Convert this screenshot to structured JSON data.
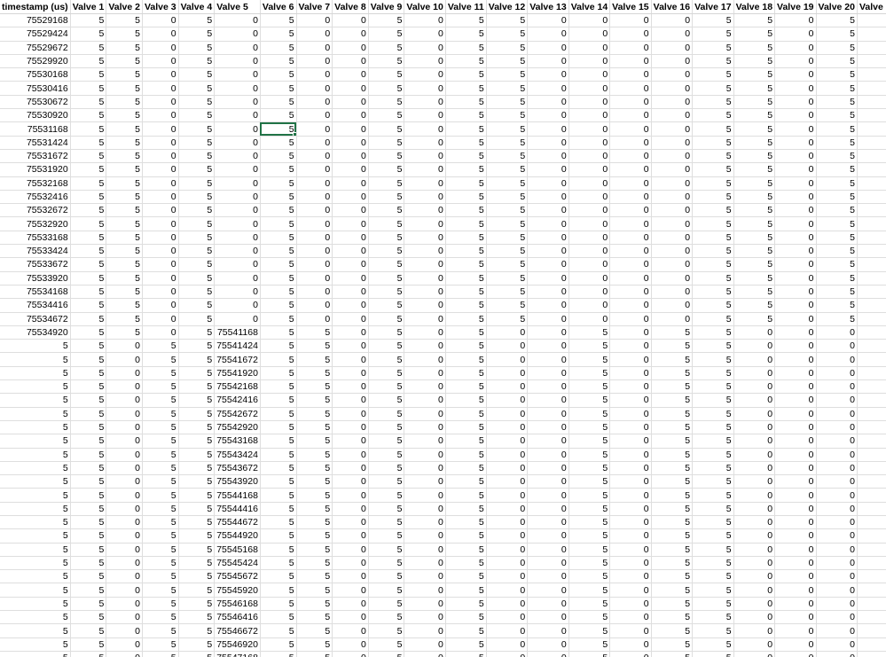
{
  "sheet": {
    "headers": [
      "timestamp (us)",
      "Valve 1",
      "Valve 2",
      "Valve 3",
      "Valve 4",
      "Valve 5",
      "Valve 6",
      "Valve 7",
      "Valve 8",
      "Valve 9",
      "Valve 10",
      "Valve 11",
      "Valve 12",
      "Valve 13",
      "Valve 14",
      "Valve 15",
      "Valve 16",
      "Valve 17",
      "Valve 18",
      "Valve 19",
      "Valve 20",
      "Valve 21"
    ],
    "selected_cell": {
      "row": 8,
      "col": 6
    },
    "rows": [
      [
        "75529168",
        "5",
        "5",
        "0",
        "5",
        "0",
        "5",
        "0",
        "0",
        "5",
        "0",
        "5",
        "5",
        "0",
        "0",
        "0",
        "0",
        "5",
        "5",
        "0",
        "5",
        "5"
      ],
      [
        "75529424",
        "5",
        "5",
        "0",
        "5",
        "0",
        "5",
        "0",
        "0",
        "5",
        "0",
        "5",
        "5",
        "0",
        "0",
        "0",
        "0",
        "5",
        "5",
        "0",
        "5",
        "5"
      ],
      [
        "75529672",
        "5",
        "5",
        "0",
        "5",
        "0",
        "5",
        "0",
        "0",
        "5",
        "0",
        "5",
        "5",
        "0",
        "0",
        "0",
        "0",
        "5",
        "5",
        "0",
        "5",
        "5"
      ],
      [
        "75529920",
        "5",
        "5",
        "0",
        "5",
        "0",
        "5",
        "0",
        "0",
        "5",
        "0",
        "5",
        "5",
        "0",
        "0",
        "0",
        "0",
        "5",
        "5",
        "0",
        "5",
        "5"
      ],
      [
        "75530168",
        "5",
        "5",
        "0",
        "5",
        "0",
        "5",
        "0",
        "0",
        "5",
        "0",
        "5",
        "5",
        "0",
        "0",
        "0",
        "0",
        "5",
        "5",
        "0",
        "5",
        "5"
      ],
      [
        "75530416",
        "5",
        "5",
        "0",
        "5",
        "0",
        "5",
        "0",
        "0",
        "5",
        "0",
        "5",
        "5",
        "0",
        "0",
        "0",
        "0",
        "5",
        "5",
        "0",
        "5",
        "5"
      ],
      [
        "75530672",
        "5",
        "5",
        "0",
        "5",
        "0",
        "5",
        "0",
        "0",
        "5",
        "0",
        "5",
        "5",
        "0",
        "0",
        "0",
        "0",
        "5",
        "5",
        "0",
        "5",
        "5"
      ],
      [
        "75530920",
        "5",
        "5",
        "0",
        "5",
        "0",
        "5",
        "0",
        "0",
        "5",
        "0",
        "5",
        "5",
        "0",
        "0",
        "0",
        "0",
        "5",
        "5",
        "0",
        "5",
        "5"
      ],
      [
        "75531168",
        "5",
        "5",
        "0",
        "5",
        "0",
        "5",
        "0",
        "0",
        "5",
        "0",
        "5",
        "5",
        "0",
        "0",
        "0",
        "0",
        "5",
        "5",
        "0",
        "5",
        "5"
      ],
      [
        "75531424",
        "5",
        "5",
        "0",
        "5",
        "0",
        "5",
        "0",
        "0",
        "5",
        "0",
        "5",
        "5",
        "0",
        "0",
        "0",
        "0",
        "5",
        "5",
        "0",
        "5",
        "5"
      ],
      [
        "75531672",
        "5",
        "5",
        "0",
        "5",
        "0",
        "5",
        "0",
        "0",
        "5",
        "0",
        "5",
        "5",
        "0",
        "0",
        "0",
        "0",
        "5",
        "5",
        "0",
        "5",
        "5"
      ],
      [
        "75531920",
        "5",
        "5",
        "0",
        "5",
        "0",
        "5",
        "0",
        "0",
        "5",
        "0",
        "5",
        "5",
        "0",
        "0",
        "0",
        "0",
        "5",
        "5",
        "0",
        "5",
        "5"
      ],
      [
        "75532168",
        "5",
        "5",
        "0",
        "5",
        "0",
        "5",
        "0",
        "0",
        "5",
        "0",
        "5",
        "5",
        "0",
        "0",
        "0",
        "0",
        "5",
        "5",
        "0",
        "5",
        "5"
      ],
      [
        "75532416",
        "5",
        "5",
        "0",
        "5",
        "0",
        "5",
        "0",
        "0",
        "5",
        "0",
        "5",
        "5",
        "0",
        "0",
        "0",
        "0",
        "5",
        "5",
        "0",
        "5",
        "5"
      ],
      [
        "75532672",
        "5",
        "5",
        "0",
        "5",
        "0",
        "5",
        "0",
        "0",
        "5",
        "0",
        "5",
        "5",
        "0",
        "0",
        "0",
        "0",
        "5",
        "5",
        "0",
        "5",
        "5"
      ],
      [
        "75532920",
        "5",
        "5",
        "0",
        "5",
        "0",
        "5",
        "0",
        "0",
        "5",
        "0",
        "5",
        "5",
        "0",
        "0",
        "0",
        "0",
        "5",
        "5",
        "0",
        "5",
        "5"
      ],
      [
        "75533168",
        "5",
        "5",
        "0",
        "5",
        "0",
        "5",
        "0",
        "0",
        "5",
        "0",
        "5",
        "5",
        "0",
        "0",
        "0",
        "0",
        "5",
        "5",
        "0",
        "5",
        "5"
      ],
      [
        "75533424",
        "5",
        "5",
        "0",
        "5",
        "0",
        "5",
        "0",
        "0",
        "5",
        "0",
        "5",
        "5",
        "0",
        "0",
        "0",
        "0",
        "5",
        "5",
        "0",
        "5",
        "5"
      ],
      [
        "75533672",
        "5",
        "5",
        "0",
        "5",
        "0",
        "5",
        "0",
        "0",
        "5",
        "0",
        "5",
        "5",
        "0",
        "0",
        "0",
        "0",
        "5",
        "5",
        "0",
        "5",
        "5"
      ],
      [
        "75533920",
        "5",
        "5",
        "0",
        "5",
        "0",
        "5",
        "0",
        "0",
        "5",
        "0",
        "5",
        "5",
        "0",
        "0",
        "0",
        "0",
        "5",
        "5",
        "0",
        "5",
        "5"
      ],
      [
        "75534168",
        "5",
        "5",
        "0",
        "5",
        "0",
        "5",
        "0",
        "0",
        "5",
        "0",
        "5",
        "5",
        "0",
        "0",
        "0",
        "0",
        "5",
        "5",
        "0",
        "5",
        "5"
      ],
      [
        "75534416",
        "5",
        "5",
        "0",
        "5",
        "0",
        "5",
        "0",
        "0",
        "5",
        "0",
        "5",
        "5",
        "0",
        "0",
        "0",
        "0",
        "5",
        "5",
        "0",
        "5",
        "5"
      ],
      [
        "75534672",
        "5",
        "5",
        "0",
        "5",
        "0",
        "5",
        "0",
        "0",
        "5",
        "0",
        "5",
        "5",
        "0",
        "0",
        "0",
        "0",
        "5",
        "5",
        "0",
        "5",
        "5"
      ],
      [
        "75534920",
        "5",
        "5",
        "0",
        "5",
        "75541168",
        "5",
        "5",
        "0",
        "5",
        "0",
        "5",
        "0",
        "0",
        "5",
        "0",
        "5",
        "5",
        "0",
        "0",
        "0",
        "0"
      ],
      [
        "5",
        "5",
        "0",
        "5",
        "5",
        "75541424",
        "5",
        "5",
        "0",
        "5",
        "0",
        "5",
        "0",
        "0",
        "5",
        "0",
        "5",
        "5",
        "0",
        "0",
        "0",
        "0"
      ],
      [
        "5",
        "5",
        "0",
        "5",
        "5",
        "75541672",
        "5",
        "5",
        "0",
        "5",
        "0",
        "5",
        "0",
        "0",
        "5",
        "0",
        "5",
        "5",
        "0",
        "0",
        "0",
        "0"
      ],
      [
        "5",
        "5",
        "0",
        "5",
        "5",
        "75541920",
        "5",
        "5",
        "0",
        "5",
        "0",
        "5",
        "0",
        "0",
        "5",
        "0",
        "5",
        "5",
        "0",
        "0",
        "0",
        "0"
      ],
      [
        "5",
        "5",
        "0",
        "5",
        "5",
        "75542168",
        "5",
        "5",
        "0",
        "5",
        "0",
        "5",
        "0",
        "0",
        "5",
        "0",
        "5",
        "5",
        "0",
        "0",
        "0",
        "0"
      ],
      [
        "5",
        "5",
        "0",
        "5",
        "5",
        "75542416",
        "5",
        "5",
        "0",
        "5",
        "0",
        "5",
        "0",
        "0",
        "5",
        "0",
        "5",
        "5",
        "0",
        "0",
        "0",
        "0"
      ],
      [
        "5",
        "5",
        "0",
        "5",
        "5",
        "75542672",
        "5",
        "5",
        "0",
        "5",
        "0",
        "5",
        "0",
        "0",
        "5",
        "0",
        "5",
        "5",
        "0",
        "0",
        "0",
        "0"
      ],
      [
        "5",
        "5",
        "0",
        "5",
        "5",
        "75542920",
        "5",
        "5",
        "0",
        "5",
        "0",
        "5",
        "0",
        "0",
        "5",
        "0",
        "5",
        "5",
        "0",
        "0",
        "0",
        "0"
      ],
      [
        "5",
        "5",
        "0",
        "5",
        "5",
        "75543168",
        "5",
        "5",
        "0",
        "5",
        "0",
        "5",
        "0",
        "0",
        "5",
        "0",
        "5",
        "5",
        "0",
        "0",
        "0",
        "0"
      ],
      [
        "5",
        "5",
        "0",
        "5",
        "5",
        "75543424",
        "5",
        "5",
        "0",
        "5",
        "0",
        "5",
        "0",
        "0",
        "5",
        "0",
        "5",
        "5",
        "0",
        "0",
        "0",
        "0"
      ],
      [
        "5",
        "5",
        "0",
        "5",
        "5",
        "75543672",
        "5",
        "5",
        "0",
        "5",
        "0",
        "5",
        "0",
        "0",
        "5",
        "0",
        "5",
        "5",
        "0",
        "0",
        "0",
        "0"
      ],
      [
        "5",
        "5",
        "0",
        "5",
        "5",
        "75543920",
        "5",
        "5",
        "0",
        "5",
        "0",
        "5",
        "0",
        "0",
        "5",
        "0",
        "5",
        "5",
        "0",
        "0",
        "0",
        "0"
      ],
      [
        "5",
        "5",
        "0",
        "5",
        "5",
        "75544168",
        "5",
        "5",
        "0",
        "5",
        "0",
        "5",
        "0",
        "0",
        "5",
        "0",
        "5",
        "5",
        "0",
        "0",
        "0",
        "0"
      ],
      [
        "5",
        "5",
        "0",
        "5",
        "5",
        "75544416",
        "5",
        "5",
        "0",
        "5",
        "0",
        "5",
        "0",
        "0",
        "5",
        "0",
        "5",
        "5",
        "0",
        "0",
        "0",
        "0"
      ],
      [
        "5",
        "5",
        "0",
        "5",
        "5",
        "75544672",
        "5",
        "5",
        "0",
        "5",
        "0",
        "5",
        "0",
        "0",
        "5",
        "0",
        "5",
        "5",
        "0",
        "0",
        "0",
        "0"
      ],
      [
        "5",
        "5",
        "0",
        "5",
        "5",
        "75544920",
        "5",
        "5",
        "0",
        "5",
        "0",
        "5",
        "0",
        "0",
        "5",
        "0",
        "5",
        "5",
        "0",
        "0",
        "0",
        "0"
      ],
      [
        "5",
        "5",
        "0",
        "5",
        "5",
        "75545168",
        "5",
        "5",
        "0",
        "5",
        "0",
        "5",
        "0",
        "0",
        "5",
        "0",
        "5",
        "5",
        "0",
        "0",
        "0",
        "0"
      ],
      [
        "5",
        "5",
        "0",
        "5",
        "5",
        "75545424",
        "5",
        "5",
        "0",
        "5",
        "0",
        "5",
        "0",
        "0",
        "5",
        "0",
        "5",
        "5",
        "0",
        "0",
        "0",
        "0"
      ],
      [
        "5",
        "5",
        "0",
        "5",
        "5",
        "75545672",
        "5",
        "5",
        "0",
        "5",
        "0",
        "5",
        "0",
        "0",
        "5",
        "0",
        "5",
        "5",
        "0",
        "0",
        "0",
        "0"
      ],
      [
        "5",
        "5",
        "0",
        "5",
        "5",
        "75545920",
        "5",
        "5",
        "0",
        "5",
        "0",
        "5",
        "0",
        "0",
        "5",
        "0",
        "5",
        "5",
        "0",
        "0",
        "0",
        "0"
      ],
      [
        "5",
        "5",
        "0",
        "5",
        "5",
        "75546168",
        "5",
        "5",
        "0",
        "5",
        "0",
        "5",
        "0",
        "0",
        "5",
        "0",
        "5",
        "5",
        "0",
        "0",
        "0",
        "0"
      ],
      [
        "5",
        "5",
        "0",
        "5",
        "5",
        "75546416",
        "5",
        "5",
        "0",
        "5",
        "0",
        "5",
        "0",
        "0",
        "5",
        "0",
        "5",
        "5",
        "0",
        "0",
        "0",
        "0"
      ],
      [
        "5",
        "5",
        "0",
        "5",
        "5",
        "75546672",
        "5",
        "5",
        "0",
        "5",
        "0",
        "5",
        "0",
        "0",
        "5",
        "0",
        "5",
        "5",
        "0",
        "0",
        "0",
        "0"
      ],
      [
        "5",
        "5",
        "0",
        "5",
        "5",
        "75546920",
        "5",
        "5",
        "0",
        "5",
        "0",
        "5",
        "0",
        "0",
        "5",
        "0",
        "5",
        "5",
        "0",
        "0",
        "0",
        "0"
      ],
      [
        "5",
        "5",
        "0",
        "5",
        "5",
        "75547168",
        "5",
        "5",
        "0",
        "5",
        "0",
        "5",
        "0",
        "0",
        "5",
        "0",
        "5",
        "5",
        "0",
        "0",
        "0",
        "0"
      ]
    ]
  }
}
